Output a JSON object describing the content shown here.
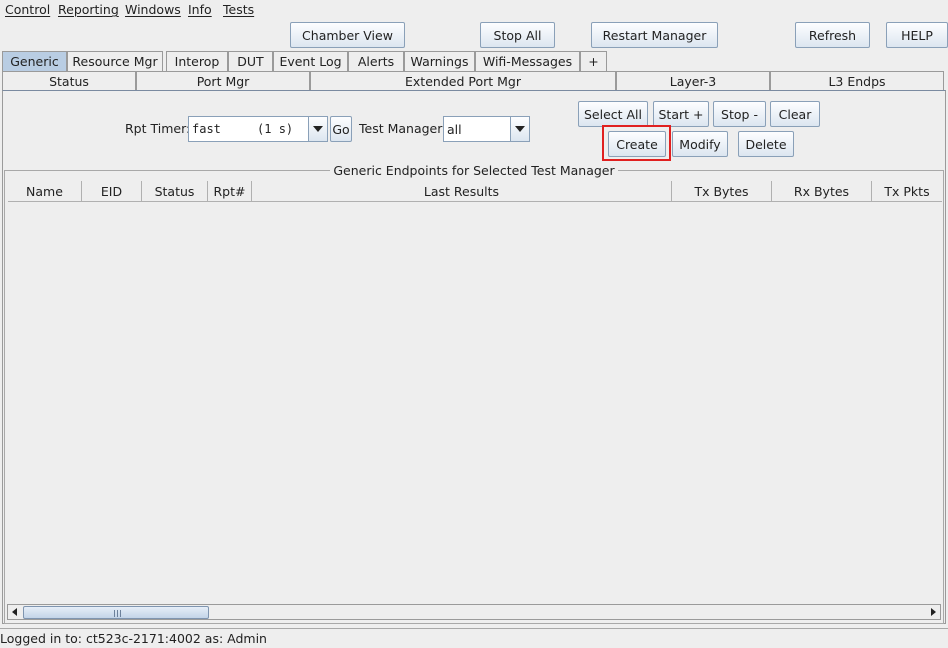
{
  "menu": {
    "control": "Control",
    "reporting": "Reporting",
    "windows": "Windows",
    "info": "Info",
    "tests": "Tests"
  },
  "toolbar": {
    "chamber_view": "Chamber View",
    "stop_all": "Stop All",
    "restart_manager": "Restart Manager",
    "refresh": "Refresh",
    "help": "HELP"
  },
  "tabs_row1": [
    "Generic",
    "Resource Mgr",
    "Interop",
    "DUT",
    "Event Log",
    "Alerts",
    "Warnings",
    "Wifi-Messages",
    "+"
  ],
  "tabs_row2": [
    "Status",
    "Port Mgr",
    "Extended Port Mgr",
    "Layer-3",
    "L3 Endps"
  ],
  "selected_tab": "Generic",
  "controls": {
    "rpt_timer_label": "Rpt Timer:",
    "rpt_timer_value": "fast     (1 s)",
    "go": "Go",
    "test_manager_label": "Test Manager",
    "test_manager_value": "all",
    "select_all": "Select All",
    "start": "Start +",
    "stop": "Stop -",
    "clear": "Clear",
    "create": "Create",
    "modify": "Modify",
    "delete": "Delete"
  },
  "table": {
    "title": "Generic Endpoints for Selected Test Manager",
    "columns": [
      "Name",
      "EID",
      "Status",
      "Rpt#",
      "Last Results",
      "Tx Bytes",
      "Rx Bytes",
      "Tx Pkts"
    ],
    "rows": []
  },
  "status": {
    "text": "Logged in to:  ct523c-2171:4002  as:  Admin"
  },
  "colors": {
    "selected_tab": "#b9cde3",
    "highlight": "#e02020"
  }
}
